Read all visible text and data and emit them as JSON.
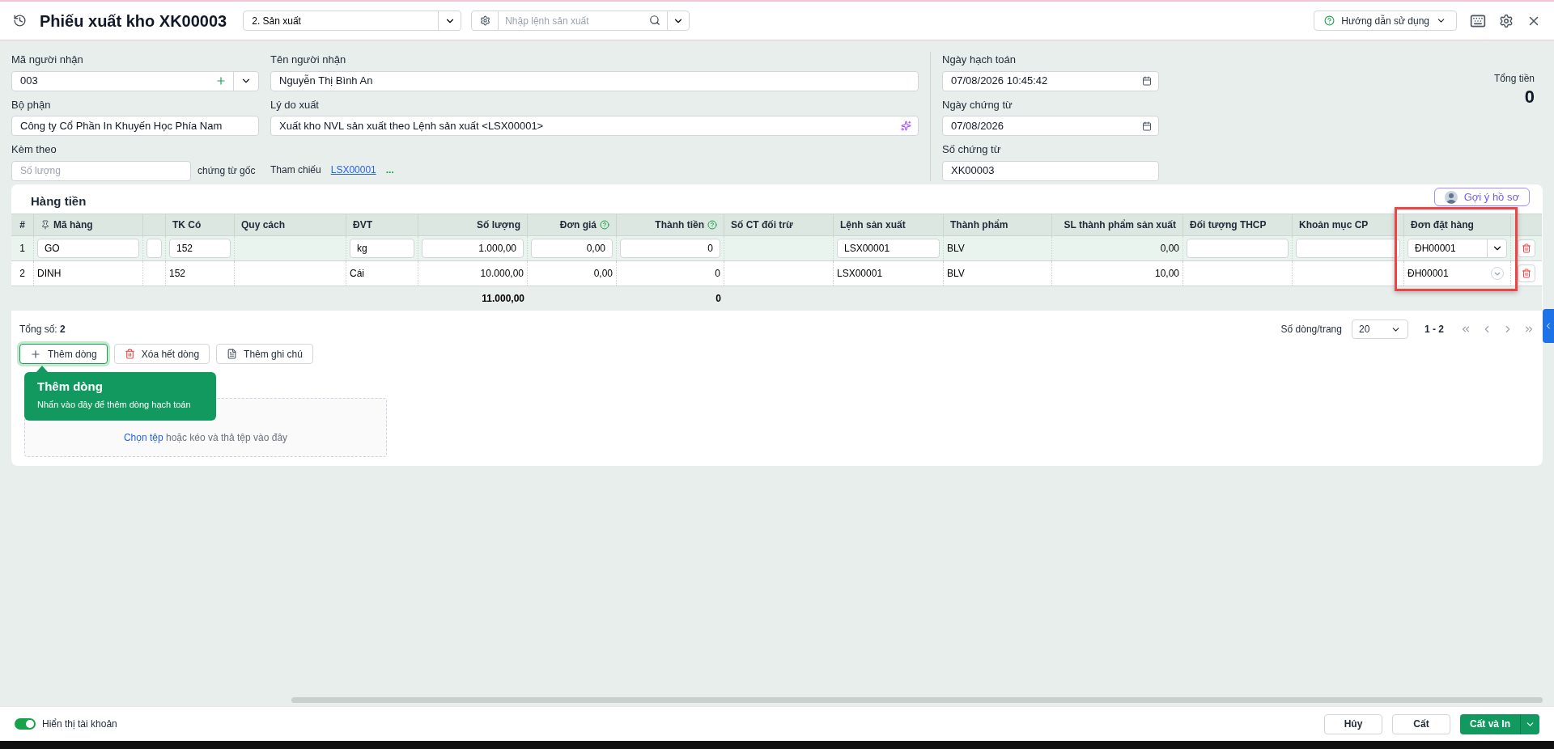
{
  "header": {
    "title": "Phiếu xuất kho XK00003",
    "type_select": "2. Sản xuất",
    "search": {
      "placeholder": "Nhập lệnh sản xuất"
    },
    "help_button": "Hướng dẫn sử dụng"
  },
  "form": {
    "recipient_code": {
      "label": "Mã người nhận",
      "value": "003"
    },
    "recipient_name": {
      "label": "Tên người nhận",
      "value": "Nguyễn Thị Bình An"
    },
    "department": {
      "label": "Bộ phận",
      "value": "Công ty Cổ Phần In Khuyến Học Phía Nam"
    },
    "reason": {
      "label": "Lý do xuất",
      "value": "Xuất kho NVL sản xuất theo Lệnh sản xuất <LSX00001>"
    },
    "attachments": {
      "label": "Kèm theo",
      "placeholder": "Số lượng",
      "suffix": "chứng từ gốc"
    },
    "reference": {
      "label": "Tham chiếu",
      "link": "LSX00001",
      "more": "..."
    },
    "posting_date": {
      "label": "Ngày hạch toán",
      "value": "07/08/2026 10:45:42"
    },
    "voucher_date": {
      "label": "Ngày chứng từ",
      "value": "07/08/2026"
    },
    "voucher_no": {
      "label": "Số chứng từ",
      "value": "XK00003"
    },
    "total": {
      "label": "Tổng tiền",
      "value": "0"
    }
  },
  "grid": {
    "title": "Hàng tiền",
    "suggest_button": "Gợi ý hồ sơ",
    "columns": [
      {
        "label": "#",
        "kind": "index",
        "editable": false,
        "highlighted": false
      },
      {
        "label": "Mã hàng",
        "kind": "text",
        "editable": true,
        "highlighted": false
      },
      {
        "kind": "text",
        "editable": true,
        "highlighted": false
      },
      {
        "label": "TK Có",
        "kind": "text",
        "editable": true,
        "highlighted": false
      },
      {
        "label": "Quy cách",
        "kind": "text",
        "editable": false,
        "highlighted": false
      },
      {
        "label": "ĐVT",
        "kind": "text",
        "editable": true,
        "highlighted": false
      },
      {
        "label": "Số lượng",
        "kind": "number",
        "editable": true,
        "highlighted": false
      },
      {
        "label": "Đơn giá",
        "kind": "number",
        "editable": true,
        "highlighted": false
      },
      {
        "label": "Thành tiền",
        "kind": "number",
        "editable": true,
        "highlighted": false
      },
      {
        "label": "Số CT đối trừ",
        "kind": "text",
        "editable": false,
        "highlighted": false
      },
      {
        "label": "Lệnh sản xuất",
        "kind": "text",
        "editable": true,
        "highlighted": false
      },
      {
        "label": "Thành phẩm",
        "kind": "text",
        "editable": false,
        "highlighted": false
      },
      {
        "label": "SL thành phẩm sản xuất",
        "kind": "number",
        "editable": false,
        "highlighted": false
      },
      {
        "label": "Đối tượng THCP",
        "kind": "text",
        "editable": true,
        "highlighted": false
      },
      {
        "label": "Khoản mục CP",
        "kind": "text",
        "editable": true,
        "highlighted": false
      },
      {
        "label": "Đơn đặt hàng",
        "kind": "select",
        "editable": true,
        "highlighted": true
      }
    ],
    "rows": [
      {
        "selected": true,
        "index": "1",
        "item_code": "GO",
        "account": "152",
        "unit": "kg",
        "quantity": "1.000,00",
        "unit_price": "0,00",
        "amount": "0",
        "production_order": "LSX00001",
        "product": "BLV",
        "product_qty": "0,00",
        "sales_order": "ĐH00001"
      },
      {
        "selected": false,
        "index": "2",
        "item_code": "DINH",
        "account": "152",
        "unit": "Cái",
        "quantity": "10.000,00",
        "unit_price": "0,00",
        "amount": "0",
        "production_order": "LSX00001",
        "product": "BLV",
        "product_qty": "10,00",
        "sales_order": "ĐH00001"
      }
    ],
    "totals": {
      "quantity": "11.000,00",
      "amount": "0"
    },
    "total_count": {
      "label": "Tổng số:",
      "value": "2"
    },
    "buttons": [
      {
        "kind": "add",
        "label": "Thêm dòng",
        "focused": true
      },
      {
        "kind": "delete",
        "label": "Xóa hết dòng",
        "focused": false
      },
      {
        "kind": "note",
        "label": "Thêm ghi chú",
        "focused": false
      }
    ],
    "pagination": {
      "label": "Số dòng/trang",
      "page_size": "20",
      "range": "1 - 2"
    },
    "tooltip": {
      "title": "Thêm dòng",
      "text": "Nhấn vào đây để thêm dòng hạch toán"
    },
    "dropzone": {
      "link": "Chọn tệp",
      "text": "hoặc kéo và thả tệp vào đây"
    }
  },
  "bottom_bar": {
    "toggle": {
      "label": "Hiển thị tài khoản",
      "on": true
    },
    "buttons": [
      {
        "kind": "secondary",
        "label": "Hủy"
      },
      {
        "kind": "secondary",
        "label": "Cất"
      },
      {
        "kind": "primary",
        "label": "Cất và In"
      }
    ]
  }
}
